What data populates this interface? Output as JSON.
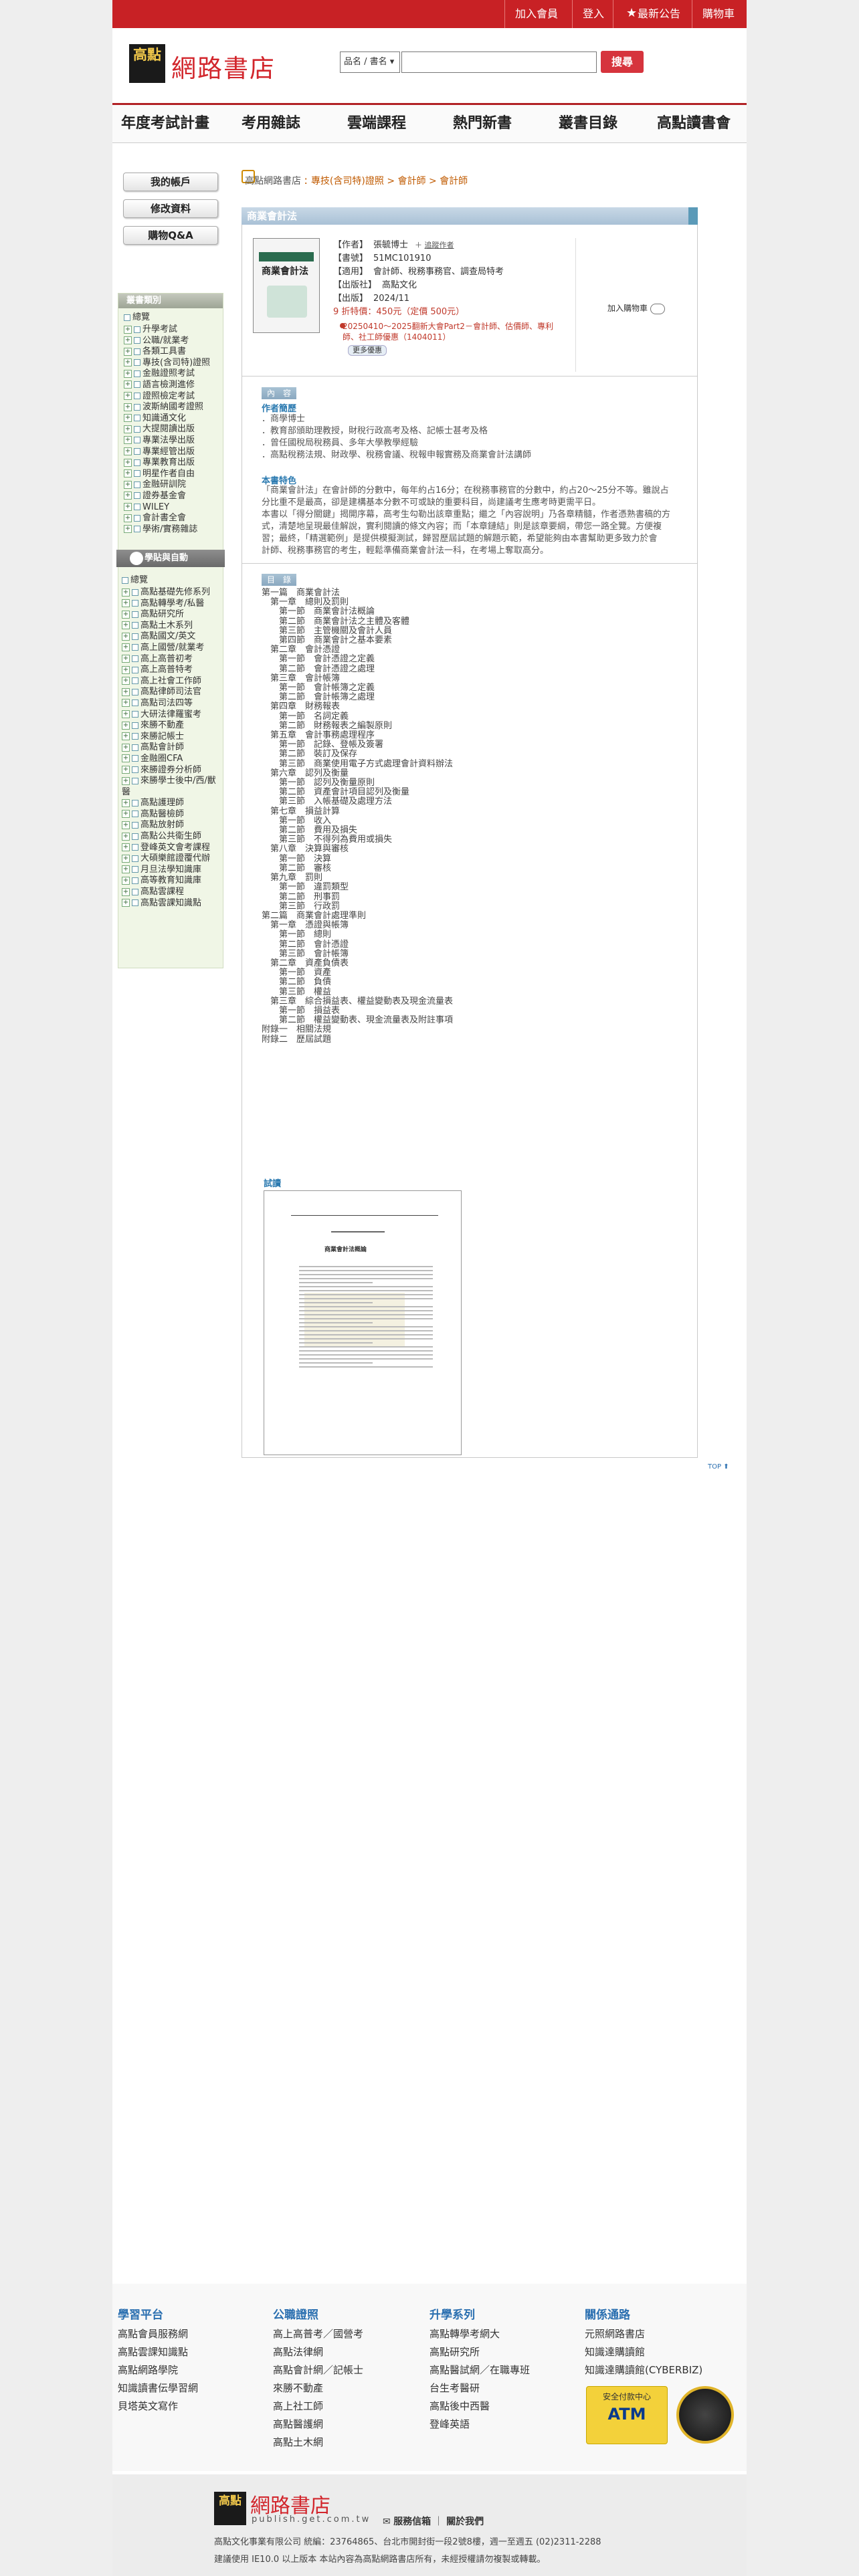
{
  "top_links": [
    "加入會員",
    "登入",
    "最新公告",
    "購物車"
  ],
  "site": {
    "logo_mark": "高點",
    "name": "網路書店"
  },
  "search": {
    "type_selected": "品名 / 書名",
    "button": "搜尋"
  },
  "nav": [
    "年度考試計畫",
    "考用雜誌",
    "雲端課程",
    "熱門新書",
    "叢書目錄",
    "高點讀書會"
  ],
  "account": [
    "我的帳戶",
    "修改資料",
    "購物Q&A"
  ],
  "catalog": {
    "header": "叢書類別",
    "items": [
      "升學考試",
      "公職/就業考",
      "各類工具書",
      "專技(含司特)證照",
      "金融證照考試",
      "語言檢測進修",
      "證照檢定考試",
      "波斯納國考證照",
      "知識通文化",
      "大提閱讀出版",
      "專業法學出版",
      "專業經管出版",
      "專業教育出版",
      "明星作者自由",
      "金融研訓院",
      "證券基金會",
      "WILEY",
      "會計書全會",
      "學術/實務雜誌"
    ],
    "header2": "學貼與自動",
    "items2": [
      "高點基礎先修系列",
      "高點轉學考/私醫",
      "高點研究所",
      "高點土木系列",
      "高點國文/英文",
      "高上國營/就業考",
      "高上高普初考",
      "高上高普特考",
      "高上社會工作師",
      "高點律師司法官",
      "高點司法四等",
      "大研法律羅蜜考",
      "來勝不動產",
      "來勝記帳士",
      "高點會計師",
      "金融圈CFA",
      "來勝證券分析師",
      "來勝學士後中/西/獸醫",
      "高點護理師",
      "高點醫檢師",
      "高點放射師",
      "高點公共衛生師",
      "登峰英文會考課程",
      "大碩樂館證覆代辦",
      "月旦法學知識庫",
      "高等教育知識庫",
      "高點雲課程",
      "高點雲課知識點"
    ]
  },
  "breadcrumb": {
    "prefix": "高點網路書店",
    "sep": ">",
    "path": [
      "專技(含司特)證照",
      "會計師",
      "會計師"
    ]
  },
  "product": {
    "title": "商業會計法",
    "author_label": "【作者】",
    "author": "張毓博士",
    "follow": "追蹤作者",
    "code_label": "【書號】",
    "code": "51MC101910",
    "use_label": "【適用】",
    "use": "會計師、稅務事務官、調查局特考",
    "publisher_label": "【出版社】",
    "publisher": "高點文化",
    "date_label": "【出版】",
    "date": "2024/11",
    "price_text": "9 折特價：450元（定價 500元）",
    "promo": "20250410～2025翻新大會Part2－會計師、估價師、專利師、社工師優惠（1404011）",
    "more_promo": "更多優惠",
    "add_cart": "加入購物車"
  },
  "sections": {
    "intro": "內　容",
    "author_head": "作者簡歷",
    "author_lines": [
      "．商學博士",
      "．教育部頒助理教授，財稅行政高考及格、記帳士甚考及格",
      "．曾任國稅局稅務員、多年大學教學經驗",
      "．高點稅務法規、財政學、稅務會議、稅報申報實務及商業會計法講師"
    ],
    "feature_head": "本書特色",
    "feature_lines": [
      "「商業會計法」在會計師的分數中，每年約占16分；在稅務事務官的分數中，約占20～25分不等。雖說占",
      "分比重不是最高，卻是建構基本分數不可或缺的重要科目，尚建議考生應考時更需平日。",
      "本書以「得分關鍵」揭開序幕，高考生勾勒出該章重點；繼之「內容說明」乃各章精髓，作者憑熟書稿的方",
      "式，清楚地呈現最佳解說，實利閱讀的條文內容；而「本章鏈結」則是該章要綱，帶您一路全覽。方便複",
      "習；最終，「精選範例」是提供模擬測試，歸習歷屆試題的解題示範，希望能夠由本書幫助更多致力於會",
      "計師、稅務事務官的考生，輕鬆準備商業會計法一科，在考場上奪取高分。"
    ],
    "toc": "目　錄",
    "toc_lines": [
      "第一篇　商業會計法",
      "　第一章　總則及罰則",
      "　　第一節　商業會計法概論",
      "　　第二節　商業會計法之主體及客體",
      "　　第三節　主管機關及會計人員",
      "　　第四節　商業會計之基本要素",
      "　第二章　會計憑證",
      "　　第一節　會計憑證之定義",
      "　　第二節　會計憑證之處理",
      "　第三章　會計帳簿",
      "　　第一節　會計帳簿之定義",
      "　　第二節　會計帳簿之處理",
      "　第四章　財務報表",
      "　　第一節　名詞定義",
      "　　第二節　財務報表之編製原則",
      "　第五章　會計事務處理程序",
      "　　第一節　記錄、登帳及簽署",
      "　　第二節　裝訂及保存",
      "　　第三節　商業使用電子方式處理會計資料辦法",
      "　第六章　認列及衡量",
      "　　第一節　認列及衡量原則",
      "　　第二節　資產會計項目認列及衡量",
      "　　第三節　入帳基礎及處理方法",
      "　第七章　損益計算",
      "　　第一節　收入",
      "　　第二節　費用及損失",
      "　　第三節　不得列為費用或損失",
      "　第八章　決算與審核",
      "　　第一節　決算",
      "　　第二節　審核",
      "　第九章　罰則",
      "　　第一節　違罰類型",
      "　　第二節　刑事罰",
      "　　第三節　行政罰",
      "第二篇　商業會計處理準則",
      "　第一章　憑證與帳簿",
      "　　第一節　總則",
      "　　第二節　會計憑證",
      "　　第三節　會計帳簿",
      "　第二章　資產負債表",
      "　　第一節　資產",
      "　　第二節　負債",
      "　　第三節　權益",
      "　第三章　綜合損益表、權益變動表及現金流量表",
      "　　第一節　損益表",
      "　　第二節　權益變動表、現金流量表及附註事項",
      "附錄一　相關法規",
      "附錄二　歷屆試題"
    ],
    "sample": "試讀",
    "sample_title": "商業會計法概論"
  },
  "top_link": "TOP",
  "footer": {
    "cols": [
      {
        "head": "學習平台",
        "links": [
          "高點會員服務網",
          "高點雲課知識點",
          "高點網路學院",
          "知識讀書伝學習網",
          "貝塔英文寫作"
        ]
      },
      {
        "head": "公職證照",
        "links": [
          "高上高普考／國營考",
          "高點法律網",
          "高點會計網／記帳士",
          "來勝不動產",
          "高上社工師",
          "高點醫護網",
          "高點土木網"
        ]
      },
      {
        "head": "升學系列",
        "links": [
          "高點轉學考網大",
          "高點研究所",
          "高點醫試網／在職專班",
          "台生考醫研",
          "高點後中西醫",
          "登峰英語"
        ]
      },
      {
        "head": "關係通路",
        "links": [
          "元照網路書店",
          "知識達購讀館",
          "知識達購讀館(CYBERBIZ)"
        ]
      }
    ],
    "badge": "安全付款中心",
    "badge2": "ATM",
    "url": "publish.get.com.tw",
    "service": "服務信箱",
    "about": "關於我們",
    "company": "高點文化事業有限公司 統編：23764865、台北市開封街一段2號8樓，週一至週五 (02)2311-2288",
    "notice": "建議使用 IE10.0 以上版本 本站內容為高點網路書店所有，未經授權請勿複製或轉載。"
  }
}
